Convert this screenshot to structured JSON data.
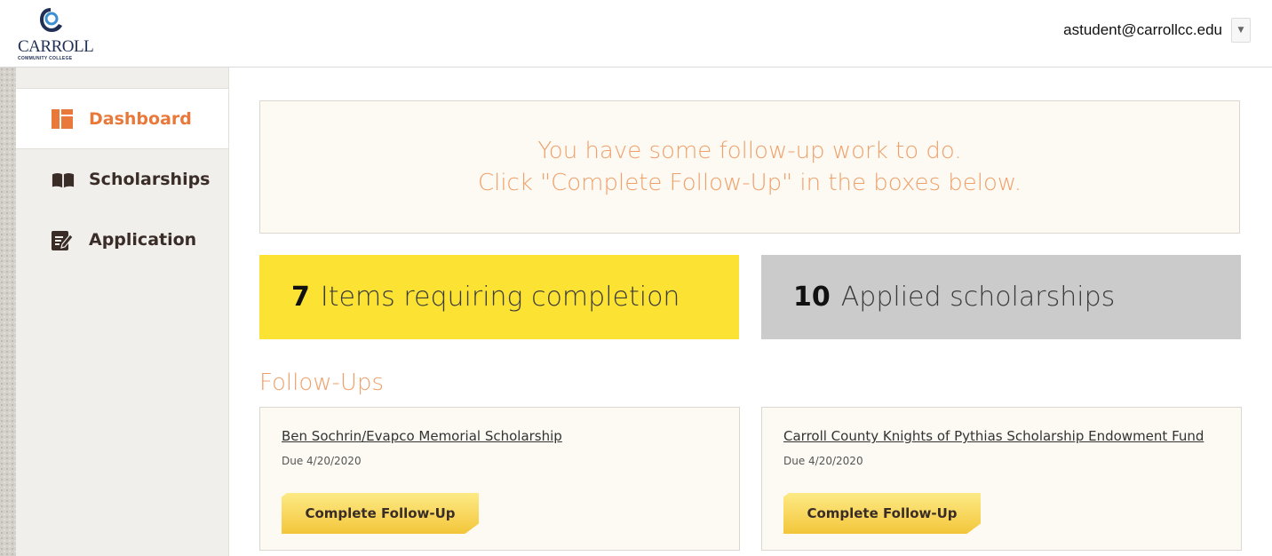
{
  "header": {
    "logo": {
      "name": "CARROLL",
      "subtitle": "COMMUNITY COLLEGE"
    },
    "user_email": "astudent@carrollcc.edu",
    "dropdown_icon": "caret-down-icon"
  },
  "sidebar": {
    "items": [
      {
        "label": "Dashboard",
        "icon": "dashboard-icon",
        "active": true
      },
      {
        "label": "Scholarships",
        "icon": "book-icon",
        "active": false
      },
      {
        "label": "Application",
        "icon": "edit-document-icon",
        "active": false
      }
    ]
  },
  "main": {
    "notice": {
      "line1": "You have some follow-up work to do.",
      "line2": "Click \"Complete Follow-Up\" in the boxes below."
    },
    "stats": [
      {
        "count": "7",
        "label": "Items requiring completion",
        "color": "#fbe233"
      },
      {
        "count": "10",
        "label": "Applied scholarships",
        "color": "#cbcbcb"
      }
    ],
    "section_title": "Follow-Ups",
    "followups": [
      {
        "title": "Ben Sochrin/Evapco Memorial Scholarship",
        "due": "Due 4/20/2020",
        "button": "Complete Follow-Up"
      },
      {
        "title": "Carroll County Knights of Pythias Scholarship Endowment Fund",
        "due": "Due 4/20/2020",
        "button": "Complete Follow-Up"
      }
    ]
  },
  "colors": {
    "accent": "#e8793a",
    "notice_text": "#f0a06b",
    "brand_navy": "#1f2f56",
    "button_gold": "#f3c63a"
  }
}
